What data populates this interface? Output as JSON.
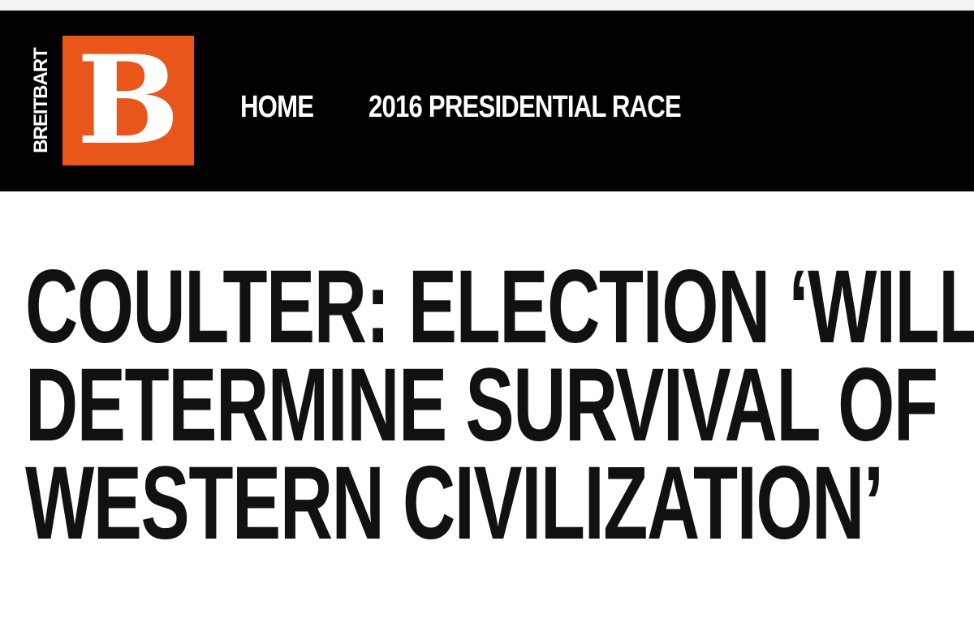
{
  "site": {
    "logo_wordmark": "BREITBART",
    "logo_letter": "B",
    "brand_color": "#e8561c",
    "header_color": "#000000"
  },
  "nav": {
    "items": [
      {
        "label": "HOME"
      },
      {
        "label": "2016 PRESIDENTIAL RACE"
      }
    ]
  },
  "article": {
    "headline_lines": [
      "COULTER: ELECTION ‘WILL",
      "DETERMINE SURVIVAL OF",
      "WESTERN CIVILIZATION’"
    ]
  }
}
